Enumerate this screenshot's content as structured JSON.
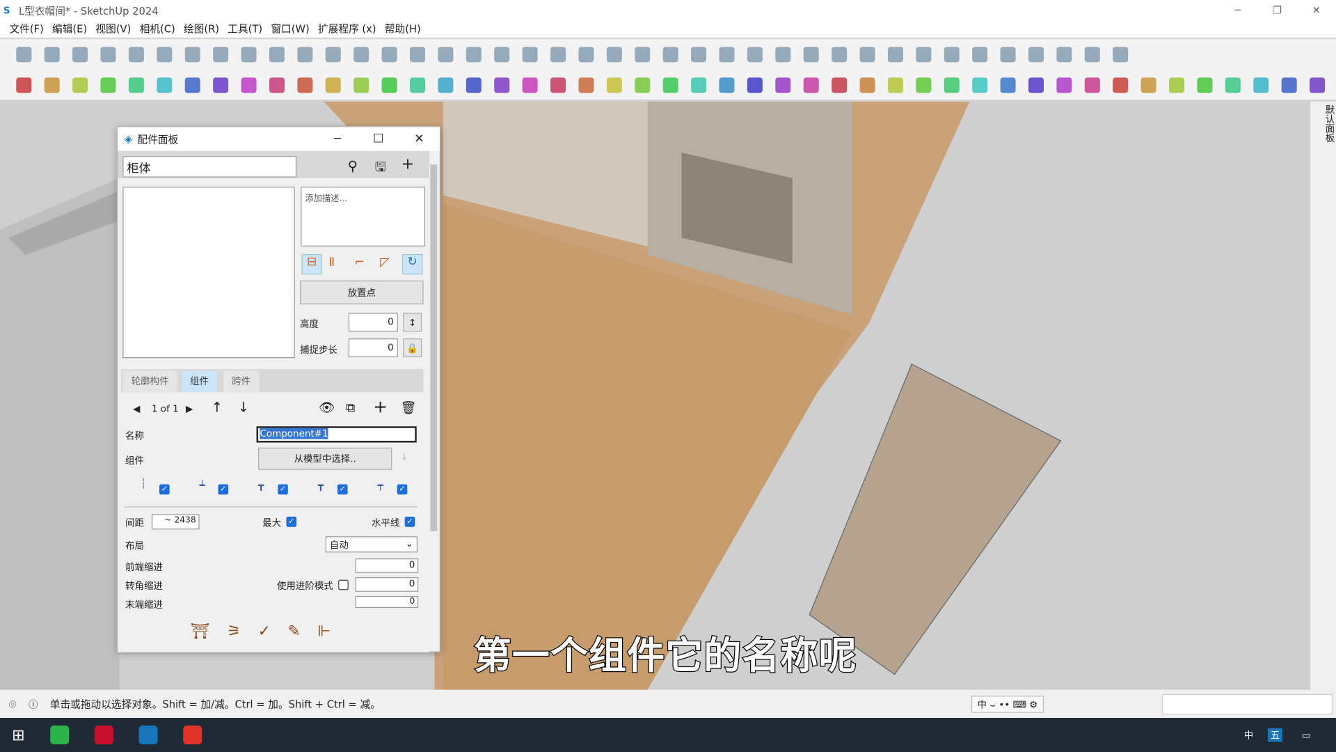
{
  "window": {
    "title": "L型衣帽间* - SketchUp 2024",
    "min": "─",
    "max": "❐",
    "close": "✕"
  },
  "menu": [
    "文件(F)",
    "编辑(E)",
    "视图(V)",
    "相机(C)",
    "绘图(R)",
    "工具(T)",
    "窗口(W)",
    "扩展程序 (x)",
    "帮助(H)"
  ],
  "toolbar1": [
    "new",
    "open",
    "save",
    "cut",
    "copy",
    "paste",
    "erase",
    "undo",
    "redo",
    "print",
    "model-info",
    "iso-view",
    "top-view",
    "front-view",
    "right-view",
    "back-view",
    "left-view",
    "bottom-view",
    "xray",
    "wireframe",
    "hidden-line",
    "shaded",
    "shaded-textures",
    "monochrome",
    "warehouse",
    "extension-warehouse",
    "3d-warehouse",
    "share",
    "layout",
    "style-builder",
    "add",
    "shield",
    "chart",
    "checker",
    "cloud",
    "settings",
    "windows",
    "info",
    "cart",
    "account"
  ],
  "toolbar2": [
    "pencil",
    "dimension",
    "paint",
    "eraser",
    "stairs",
    "box",
    "profile",
    "fold",
    "ruler",
    "cut",
    "hook",
    "frame",
    "frame2",
    "blue",
    "blue2",
    "yellow",
    "green",
    "red",
    "white",
    "orange",
    "red-sq",
    "table",
    "flag",
    "wood",
    "pipe",
    "bracket",
    "dots",
    "cross-red",
    "cross-green",
    "cross-blue",
    "cone",
    "tree",
    "warning",
    "hook2",
    "curve",
    "curve2",
    "move",
    "cup",
    "undo-red",
    "green2",
    "box2",
    "red2",
    "box3",
    "rose",
    "grid",
    "panel",
    "wood2"
  ],
  "toolbar_colors": {
    "toolbar1": "#4a6d8c",
    "toolbar2": "#c8553d"
  },
  "right_tray": "默认面板",
  "panel": {
    "title": "配件面板",
    "name_field": "柜体",
    "description_placeholder": "添加描述...",
    "place_button": "放置点",
    "height_label": "高度",
    "height_value": "0",
    "snap_label": "捕捉步长",
    "snap_value": "0",
    "tabs": [
      "轮廓构件",
      "组件",
      "跨件"
    ],
    "active_tab": "组件",
    "pager": "1 of 1",
    "name_label": "名称",
    "name_value": "Component#1",
    "component_label": "组件",
    "select_button": "从模型中选择..",
    "spacing_label": "间距",
    "spacing_value": "~ 2438",
    "max_label": "最大",
    "horizontal_label": "水平线",
    "layout_label": "布局",
    "layout_value": "自动",
    "front_indent_label": "前端缩进",
    "front_indent_value": "0",
    "corner_indent_label": "转角缩进",
    "advanced_label": "使用进阶模式",
    "corner_indent_value": "0",
    "end_indent_label": "末端缩进",
    "end_indent_value": "0",
    "checks": {
      "c1": true,
      "c2": true,
      "c3": true,
      "c4": true,
      "c5": true,
      "max": true,
      "horizontal": true,
      "advanced": false
    }
  },
  "status": {
    "text": "单击或拖动以选择对象。Shift = 加/减。Ctrl = 加。Shift + Ctrl = 减。",
    "ime": "中"
  },
  "subtitle": "第一个组件它的名称呢",
  "taskbar": {
    "ime": "中",
    "ime2": "五"
  }
}
